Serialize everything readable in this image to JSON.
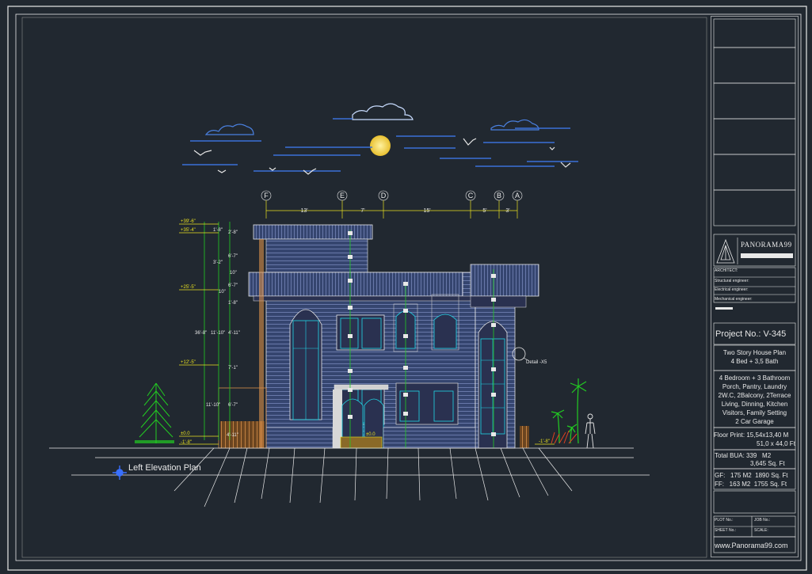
{
  "drawing": {
    "title": "Left Elevation Plan",
    "detail_callout": "Detail -X5",
    "grid_bubbles": [
      "F",
      "E",
      "D",
      "C",
      "B",
      "A"
    ],
    "grid_spacings": [
      "13'",
      "7'",
      "15'",
      "5'",
      "3'"
    ],
    "level_marks": [
      "+39'-6\"",
      "+35'-4\"",
      "+25'-5\"",
      "+12'-5\"",
      "±0.0",
      "-1'-8\"",
      "-1'-8\""
    ],
    "vertical_dims": [
      "2'-8\"",
      "6'-7\"",
      "3'-2\"",
      "1'-8\"",
      "10\"",
      "1'-8\"",
      "6'-7\"",
      "36'-8\"",
      "11'-10\"",
      "4'-11\"",
      "7'-1\"",
      "10\"",
      "6'-7\"",
      "11'-10\"",
      "4'-11\""
    ],
    "plinth_label": "±0.0"
  },
  "title_block": {
    "logo_text": "PANORAMA99",
    "architect_label": "ARCHITECT:",
    "structural_label": "Structural engineer:",
    "electrical_label": "Electrical engineer:",
    "mechanical_label": "Mechanical engineer:",
    "project_no": "Project No.: V-345",
    "plan_title_1": "Two Story House Plan",
    "plan_title_2": "4 Bed + 3,5 Bath",
    "features": [
      "4 Bedroom + 3 Bathroom",
      "Porch, Pantry, Laundry",
      "2W.C, 2Balcony, 2Terrace",
      "Living, Dinning, Kitchen",
      "Visitors, Family Setting",
      "2 Car Garage"
    ],
    "floor_print_1": "Floor Print: 15,54x13,40 M",
    "floor_print_2": "51,0 x 44,0 Ft",
    "total_bua_1": "Total BUA: 339   M2",
    "total_bua_2": "3,645 Sq. Ft",
    "gf": "GF:   175 M2  1890 Sq. Ft",
    "ff": "FF:   163 M2  1755 Sq. Ft",
    "plot_no": "PLOT No.:",
    "job_no": "JOB No.:",
    "sheet_no": "SHEET No.:",
    "scale": "SCALE:",
    "website": "www.Panorama99.com"
  },
  "colors": {
    "background": "#212830",
    "frame": "#e8e8e8",
    "facade": "#3a4a7a",
    "siding": "#8090c0",
    "green": "#22cc22",
    "yellow": "#e8e020",
    "cyan": "#20d8e8",
    "orange": "#e09040",
    "sky": "#3a70d8",
    "sun": "#f0d040"
  }
}
